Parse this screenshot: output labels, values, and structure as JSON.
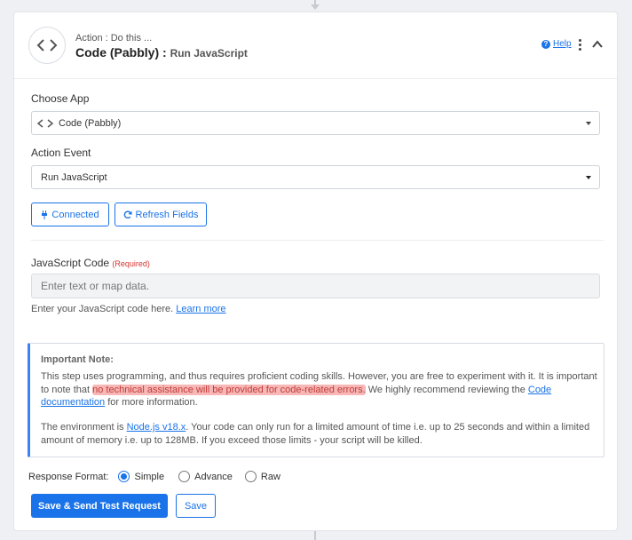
{
  "header": {
    "subtitle": "Action : Do this ...",
    "app_name": "Code (Pabbly) :",
    "event_name": "Run JavaScript",
    "help_label": "Help",
    "logo_icon": "code-brackets-icon"
  },
  "choose_app": {
    "label": "Choose App",
    "value": "Code (Pabbly)"
  },
  "action_event": {
    "label": "Action Event",
    "value": "Run JavaScript"
  },
  "buttons": {
    "connected": "Connected",
    "refresh": "Refresh Fields",
    "save_test": "Save & Send Test Request",
    "save": "Save"
  },
  "js_code": {
    "label": "JavaScript Code",
    "required": "(Required)",
    "placeholder": "Enter text or map data.",
    "hint": "Enter your JavaScript code here.",
    "hint_link": "Learn more"
  },
  "note": {
    "title": "Important Note:",
    "p1_a": "This step uses programming, and thus requires proficient coding skills. However, you are free to experiment with it. It is important to note that ",
    "p1_highlight": "no technical assistance will be provided for code-related errors.",
    "p1_b": " We highly recommend reviewing the ",
    "p1_link": "Code documentation",
    "p1_c": " for more information.",
    "p2_a": "The environment is ",
    "p2_link": "Node.js v18.x",
    "p2_b": ". Your code can only run for a limited amount of time i.e. up to 25 seconds and within a limited amount of memory i.e. up to 128MB. If you exceed those limits - your script will be killed."
  },
  "response_format": {
    "label": "Response Format:",
    "options": [
      "Simple",
      "Advance",
      "Raw"
    ],
    "selected": "Simple"
  },
  "colors": {
    "accent": "#1a73e8",
    "required": "#d3342f",
    "highlight": "#f6b7b6"
  }
}
